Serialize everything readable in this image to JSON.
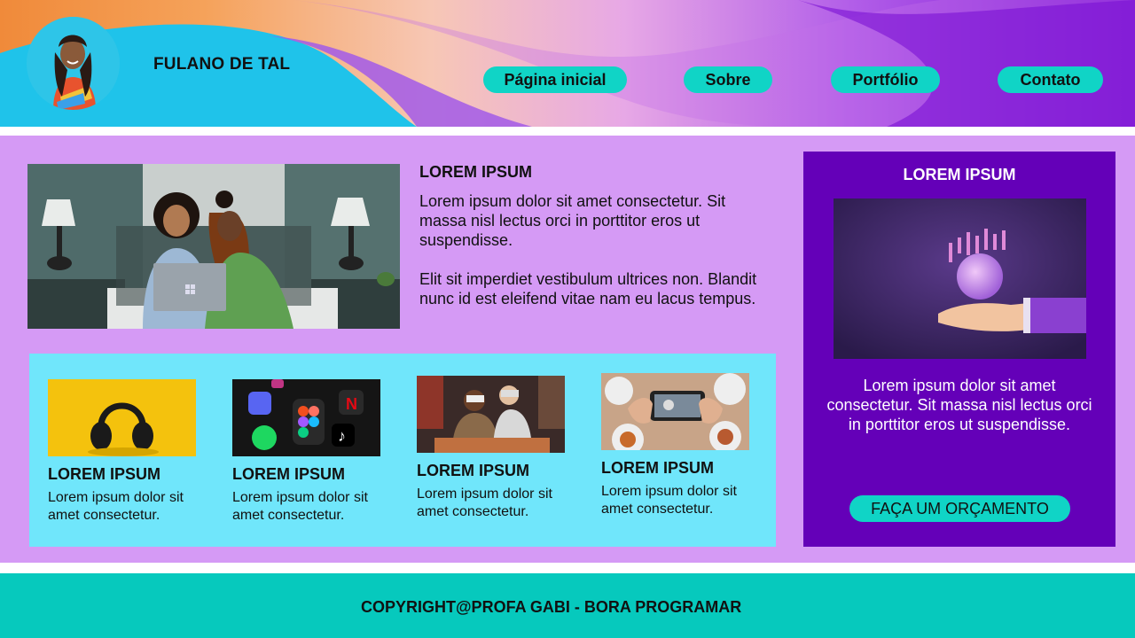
{
  "header": {
    "brand": "FULANO DE TAL",
    "nav": [
      {
        "label": "Página inicial"
      },
      {
        "label": "Sobre"
      },
      {
        "label": "Portfólio"
      },
      {
        "label": "Contato"
      }
    ]
  },
  "intro": {
    "title": "LOREM IPSUM",
    "paragraphs": [
      "Lorem ipsum dolor sit amet consectetur. Sit massa nisl lectus orci in porttitor eros ut suspendisse.",
      "Elit sit imperdiet vestibulum ultrices non. Blandit nunc id est eleifend vitae nam eu lacus tempus."
    ]
  },
  "cards": [
    {
      "title": "LOREM IPSUM",
      "text": "Lorem ipsum dolor sit amet consectetur.",
      "image": "headphones"
    },
    {
      "title": "LOREM IPSUM",
      "text": "Lorem ipsum dolor sit amet consectetur.",
      "image": "social-apps"
    },
    {
      "title": "LOREM IPSUM",
      "text": "Lorem ipsum dolor sit amet consectetur.",
      "image": "vr-gamers"
    },
    {
      "title": "LOREM IPSUM",
      "text": "Lorem ipsum dolor sit amet consectetur.",
      "image": "food-phone"
    }
  ],
  "aside": {
    "title": "LOREM IPSUM",
    "text": "Lorem ipsum dolor sit amet consectetur. Sit massa nisl lectus orci in porttitor eros ut suspendisse.",
    "button": "FAÇA UM ORÇAMENTO"
  },
  "footer": {
    "copyright": "COPYRIGHT@PROFA GABI - BORA PROGRAMAR"
  },
  "colors": {
    "accent": "#10d4c6",
    "main_bg": "#d59af5",
    "cards_bg": "#70e6fb",
    "aside_bg": "#6400b8",
    "footer_bg": "#06c9bd"
  }
}
